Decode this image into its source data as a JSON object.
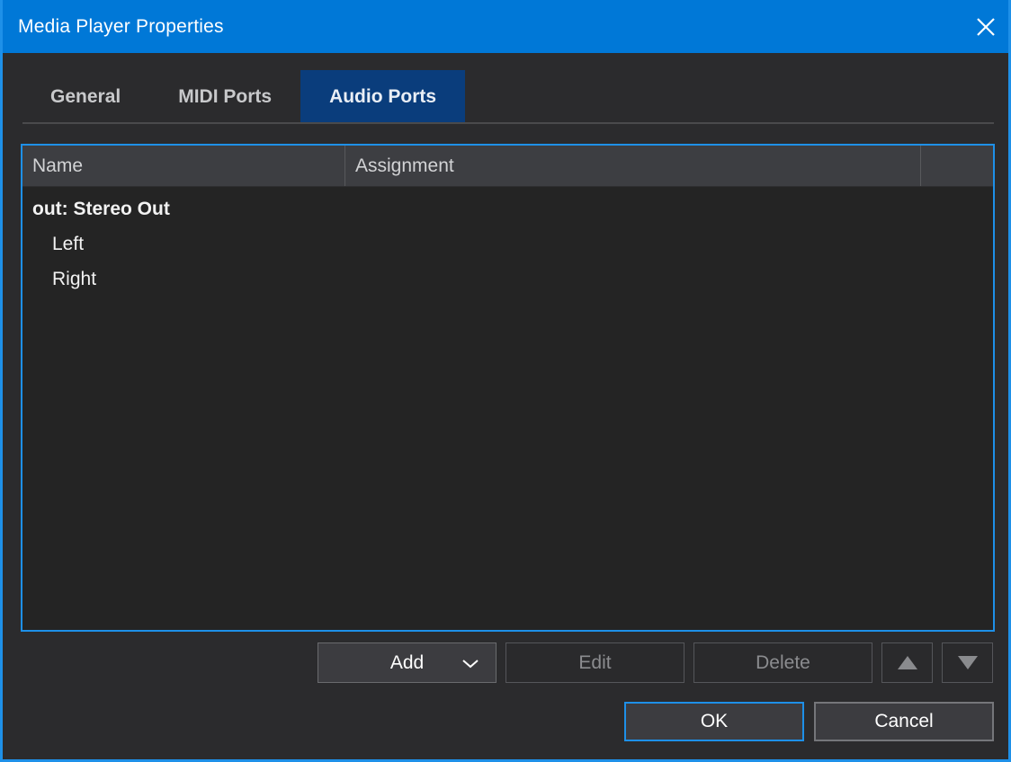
{
  "window": {
    "title": "Media Player Properties",
    "close_icon": "close-icon",
    "accent_color": "#0078d7",
    "focus_border_color": "#1e90e8",
    "background_color": "#2b2b2d"
  },
  "tabs": [
    {
      "label": "General",
      "selected": false
    },
    {
      "label": "MIDI Ports",
      "selected": false
    },
    {
      "label": "Audio Ports",
      "selected": true
    }
  ],
  "table": {
    "columns": [
      {
        "label": "Name"
      },
      {
        "label": "Assignment"
      },
      {
        "label": ""
      }
    ],
    "rows": [
      {
        "name": "out: Stereo Out",
        "assignment": "",
        "level": 0
      },
      {
        "name": "Left",
        "assignment": "",
        "level": 1
      },
      {
        "name": "Right",
        "assignment": "",
        "level": 1
      }
    ]
  },
  "actions": {
    "add_label": "Add",
    "add_dropdown_icon": "chevron-down-icon",
    "edit_label": "Edit",
    "delete_label": "Delete",
    "move_up_icon": "triangle-up-icon",
    "move_down_icon": "triangle-down-icon"
  },
  "dialog_buttons": {
    "ok_label": "OK",
    "cancel_label": "Cancel"
  }
}
